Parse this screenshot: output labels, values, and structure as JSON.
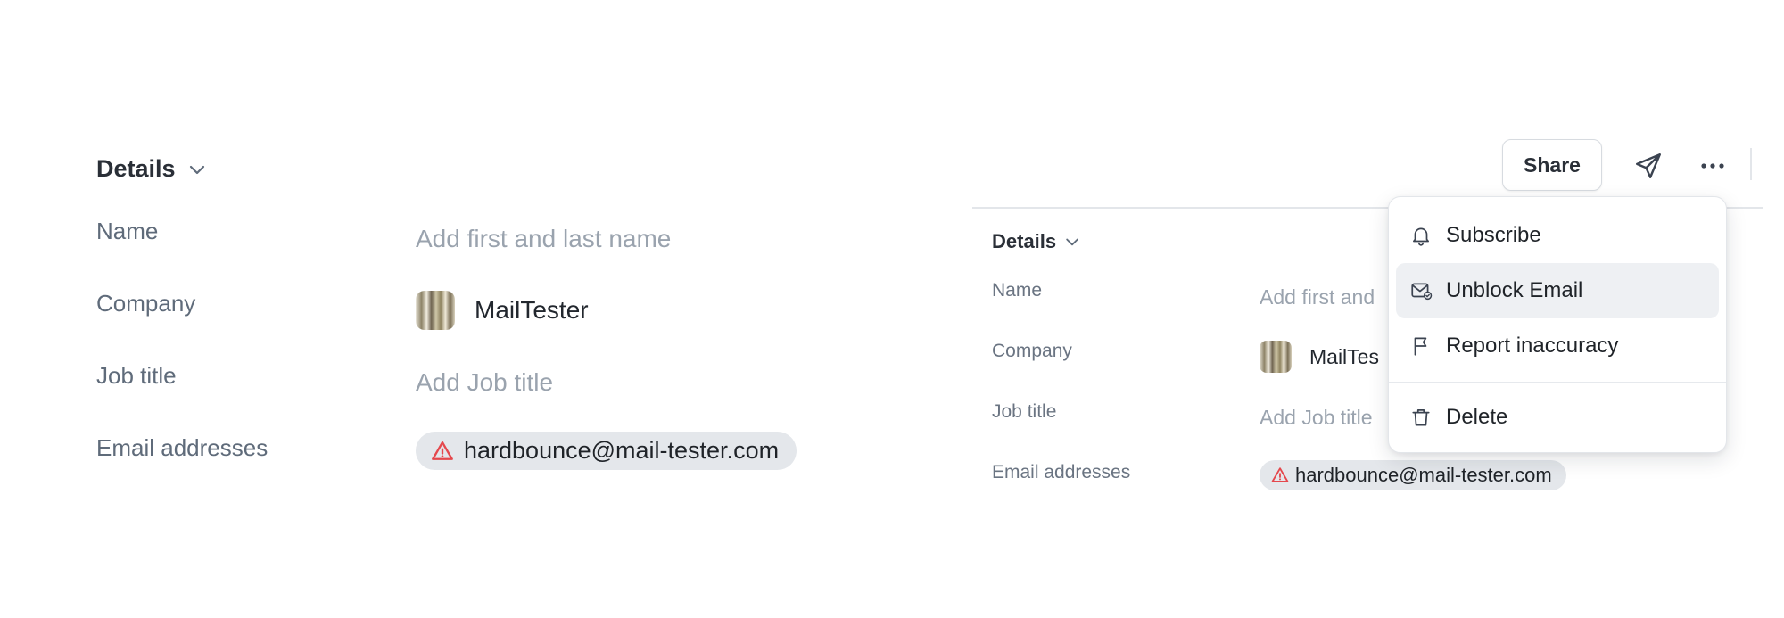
{
  "left_panel": {
    "section_title": "Details",
    "rows": [
      {
        "label": "Name",
        "value": "Add first and last name"
      },
      {
        "label": "Company",
        "value": "MailTester"
      },
      {
        "label": "Job title",
        "value": "Add Job title"
      },
      {
        "label": "Email addresses",
        "value": "hardbounce@mail-tester.com"
      }
    ]
  },
  "right_panel": {
    "toolbar": {
      "share_label": "Share",
      "send_icon": "send-icon",
      "more_icon": "more-horizontal-icon"
    },
    "section_title": "Details",
    "rows": [
      {
        "label": "Name",
        "value": "Add first and"
      },
      {
        "label": "Company",
        "value": "MailTes"
      },
      {
        "label": "Job title",
        "value": "Add Job title"
      },
      {
        "label": "Email addresses",
        "value": "hardbounce@mail-tester.com"
      }
    ]
  },
  "menu": {
    "items": [
      {
        "label": "Subscribe",
        "icon": "bell-icon"
      },
      {
        "label": "Unblock Email",
        "icon": "mail-unblock-icon"
      },
      {
        "label": "Report inaccuracy",
        "icon": "flag-icon"
      },
      {
        "label": "Delete",
        "icon": "trash-icon"
      }
    ],
    "hovered_item": "Unblock Email"
  },
  "colors": {
    "warning": "#e5484d",
    "pill_bg": "#e4e7eb",
    "label_text": "#5f6b7a",
    "placeholder_text": "#9aa3ae",
    "menu_hover": "#eef0f3"
  }
}
